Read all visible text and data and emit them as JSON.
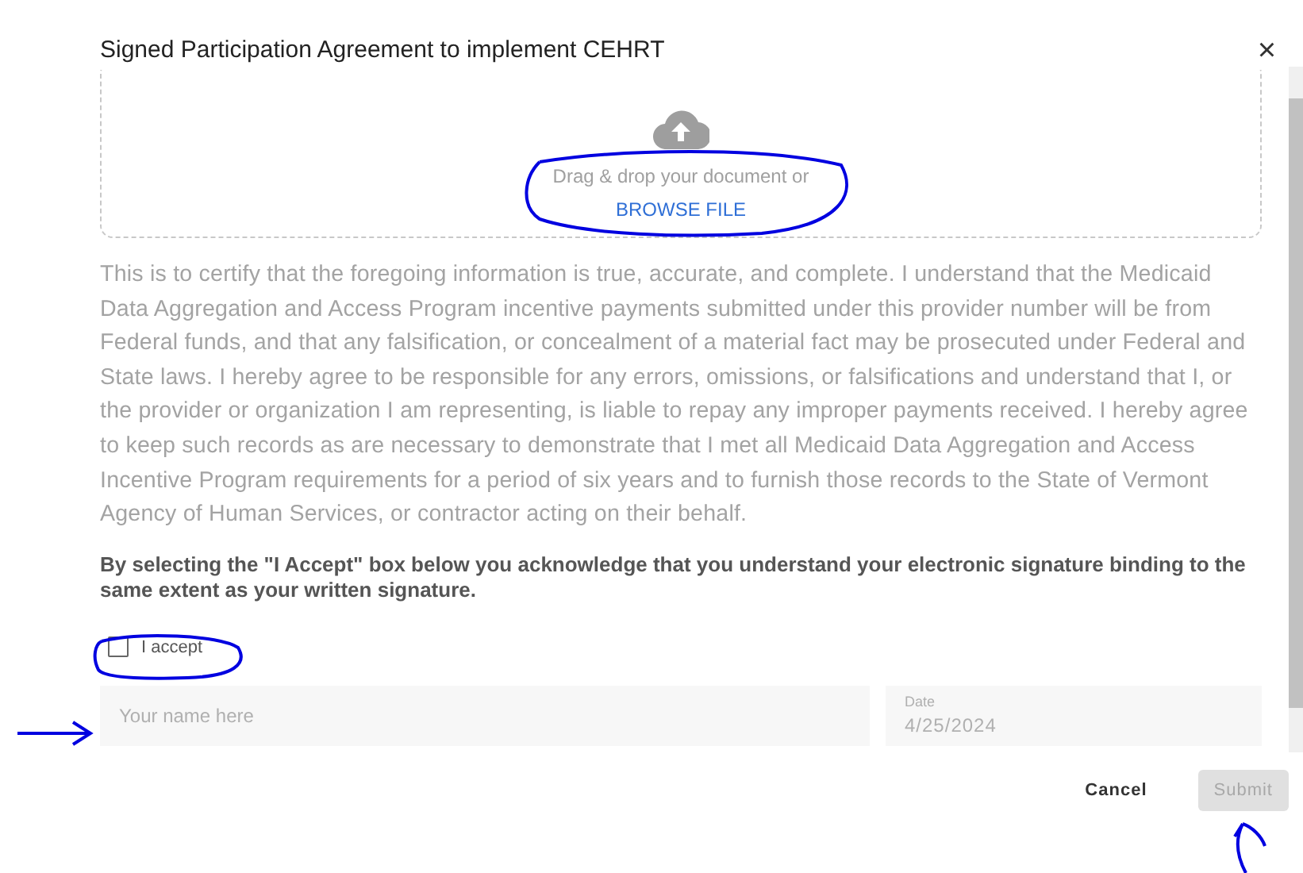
{
  "dialog": {
    "title": "Signed Participation Agreement to implement CEHRT",
    "close": "×"
  },
  "upload": {
    "prompt": "Drag & drop your document or",
    "link": "BROWSE FILE"
  },
  "certification": "This is to certify that the foregoing information is true, accurate, and complete. I understand that the Medicaid Data Aggregation and Access Program incentive payments submitted under this provider number will be from Federal funds, and that any falsification, or concealment of a material fact may be prosecuted under Federal and State laws. I hereby agree to be responsible for any errors, omissions, or falsifications and understand that I, or the provider or organization I am representing, is liable to repay any improper payments received. I hereby agree to keep such records as are necessary to demonstrate that I met all Medicaid Data Aggregation and Access Incentive Program requirements for a period of six years and to furnish those records to the State of Vermont Agency of Human Services, or contractor acting on their behalf.",
  "acknowledgement": "By selecting the \"I Accept\" box below you acknowledge that you understand your electronic signature binding to the same extent as your written signature.",
  "accept": {
    "label": "I accept",
    "checked": false
  },
  "name_field": {
    "placeholder": "Your name here"
  },
  "date_field": {
    "label": "Date",
    "value": "4/25/2024"
  },
  "buttons": [
    {
      "label": "Cancel",
      "kind": "text",
      "disabled": false
    },
    {
      "label": "Submit",
      "kind": "contained",
      "disabled": true
    }
  ]
}
